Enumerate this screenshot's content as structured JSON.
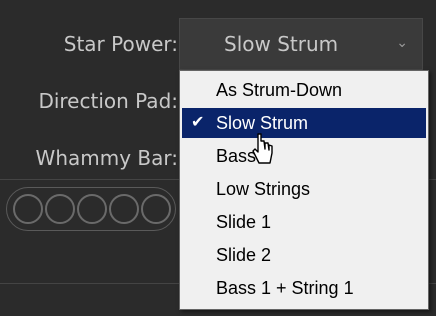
{
  "labels": {
    "star_power": "Star Power:",
    "direction_pad": "Direction Pad:",
    "whammy_bar": "Whammy Bar:"
  },
  "star_power_combo": {
    "selected": "Slow Strum",
    "arrow_icon": "chevron-down-icon"
  },
  "menu": {
    "items": [
      {
        "label": "As Strum-Down",
        "selected": false
      },
      {
        "label": "Slow Strum",
        "selected": true
      },
      {
        "label": "Bass 1",
        "selected": false
      },
      {
        "label": "Low Strings",
        "selected": false
      },
      {
        "label": "Slide 1",
        "selected": false
      },
      {
        "label": "Slide 2",
        "selected": false
      },
      {
        "label": "Bass 1 + String 1",
        "selected": false
      }
    ],
    "check_glyph": "✔",
    "highlight_color": "#0a246a"
  },
  "indicator": {
    "circle_count": 5
  }
}
